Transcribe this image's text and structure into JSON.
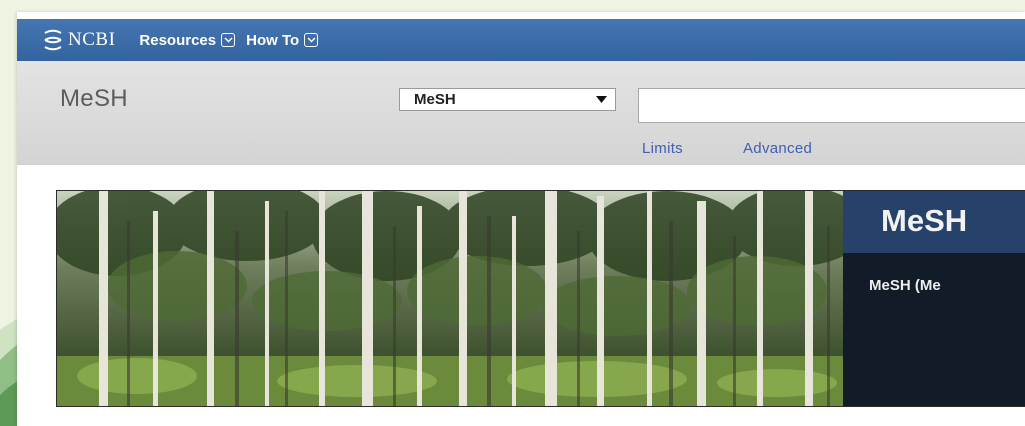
{
  "ncbi_bar": {
    "logo_text": "NCBI",
    "nav": [
      {
        "label": "Resources",
        "icon": "chevron-down-icon"
      },
      {
        "label": "How To",
        "icon": "chevron-down-icon"
      }
    ]
  },
  "search": {
    "db_title": "MeSH",
    "db_select_value": "MeSH",
    "term_value": "",
    "limits_label": "Limits",
    "advanced_label": "Advanced"
  },
  "banner": {
    "title": "MeSH",
    "description": "MeSH (Me"
  },
  "colors": {
    "ncbi_bar": "#3e6ea8",
    "search_area": "#dedede",
    "link": "#3f5fb5",
    "banner_title_bar": "#26426b",
    "banner_panel": "#121b28"
  }
}
